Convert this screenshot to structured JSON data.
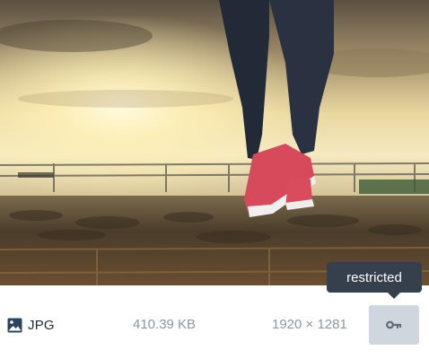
{
  "attachment": {
    "type_label": "JPG",
    "file_size": "410.39 KB",
    "dimensions": "1920 × 1281",
    "tooltip": "restricted",
    "icons": {
      "type": "image-icon",
      "action": "key-icon"
    }
  },
  "colors": {
    "footer_text": "#8a96a6",
    "type_text": "#1f2a3a",
    "button_bg": "#cfd6de",
    "tooltip_bg": "#36404d"
  }
}
